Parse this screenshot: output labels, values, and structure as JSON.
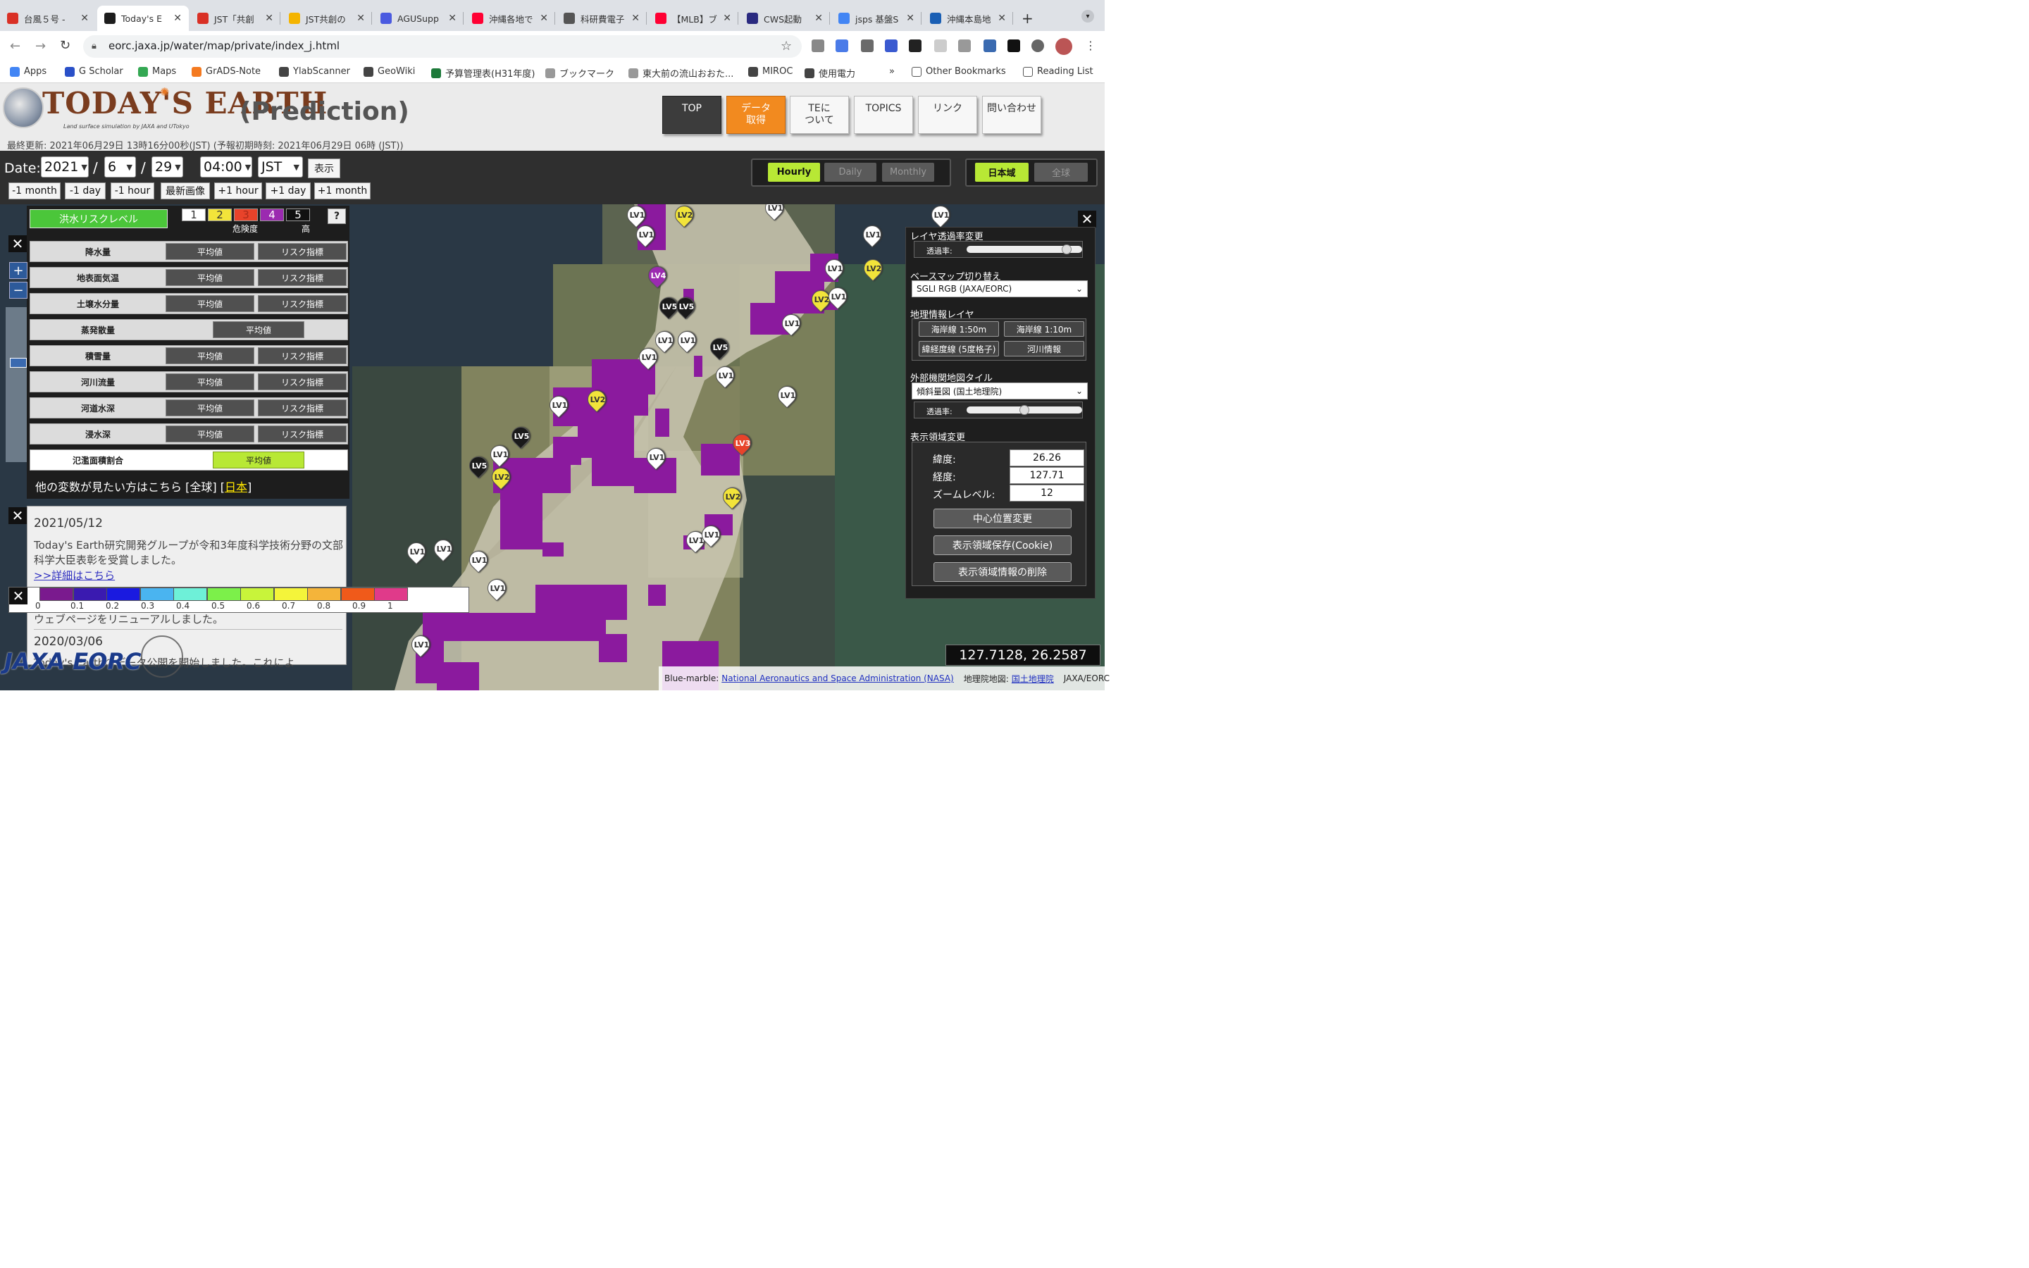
{
  "browser": {
    "tabs": [
      {
        "title": "台風５号 -",
        "favicon": "gmail-icon",
        "color": "#d93025"
      },
      {
        "title": "Today's E",
        "favicon": "eorc-icon",
        "color": "#1d1d1d"
      },
      {
        "title": "JST「共創",
        "favicon": "gmail-icon",
        "color": "#d93025"
      },
      {
        "title": "JST共創の",
        "favicon": "drive-icon",
        "color": "#f4b400"
      },
      {
        "title": "AGUSupp",
        "favicon": "dropbox-icon",
        "color": "#4a5ae0"
      },
      {
        "title": "沖縄各地で",
        "favicon": "yahoo-icon",
        "color": "#ff0033"
      },
      {
        "title": "科研費電子",
        "favicon": "globe-icon",
        "color": "#555555"
      },
      {
        "title": "【MLB】ブ",
        "favicon": "yahoo-icon",
        "color": "#ff0033"
      },
      {
        "title": "CWS起動",
        "favicon": "sphere-icon",
        "color": "#2a2a80"
      },
      {
        "title": "jsps 基盤S",
        "favicon": "google-icon",
        "color": "#4285f4"
      },
      {
        "title": "沖縄本島地",
        "favicon": "nhk-icon",
        "color": "#1a5fb4"
      }
    ],
    "url": "eorc.jaxa.jp/water/map/private/index_j.html",
    "bookmarks": [
      "Apps",
      "G Scholar",
      "Maps",
      "GrADS-Note",
      "YlabScanner",
      "GeoWiki",
      "予算管理表(H31年度)",
      "ブックマーク",
      "東大前の流山おおた...",
      "MIROC",
      "使用電力"
    ],
    "bookmarks_overflow": "»",
    "other_bookmarks": "Other Bookmarks",
    "reading_list": "Reading List"
  },
  "header": {
    "logo_title": "TODAY'S EARTH",
    "logo_subtitle": "Land surface simulation by JAXA and UTokyo",
    "mode": "(Prediction)",
    "last_update": "最終更新: 2021年06月29日 13時16分00秒(JST) (予報初期時刻: 2021年06月29日 06時 (JST))",
    "nav": [
      {
        "label": "TOP",
        "style": "dark"
      },
      {
        "label": "データ\n取得",
        "style": "orange"
      },
      {
        "label": "TEに\nついて",
        "style": "normal"
      },
      {
        "label": "TOPICS",
        "style": "normal"
      },
      {
        "label": "リンク",
        "style": "normal"
      },
      {
        "label": "問い合わせ",
        "style": "normal"
      }
    ]
  },
  "datebar": {
    "label": "Date:",
    "year": "2021",
    "month": "6",
    "day": "29",
    "time": "04:00",
    "tz": "JST",
    "show": "表示",
    "steps": [
      "-1 month",
      "-1 day",
      "-1 hour",
      "最新画像",
      "+1 hour",
      "+1 day",
      "+1 month"
    ],
    "interval": {
      "options": [
        "Hourly",
        "Daily",
        "Monthly"
      ],
      "selected": "Hourly"
    },
    "region": {
      "options": [
        "日本域",
        "全球"
      ],
      "selected": "日本域"
    }
  },
  "varpanel": {
    "risk_label": "洪水リスクレベル",
    "levels": [
      {
        "n": "1",
        "color": "#ffffff",
        "text": "#333333"
      },
      {
        "n": "2",
        "color": "#f2e43a",
        "text": "#333333"
      },
      {
        "n": "3",
        "color": "#e8432a",
        "text": "#aa2a1a"
      },
      {
        "n": "4",
        "color": "#9b2ab0",
        "text": "#ffffff"
      },
      {
        "n": "5",
        "color": "#111111",
        "text": "#ffffff"
      }
    ],
    "level_caption": "危険度",
    "level_high": "高",
    "help": "?",
    "rows": [
      {
        "name": "降水量",
        "buttons": [
          "平均値",
          "リスク指標"
        ]
      },
      {
        "name": "地表面気温",
        "buttons": [
          "平均値",
          "リスク指標"
        ]
      },
      {
        "name": "土壌水分量",
        "buttons": [
          "平均値",
          "リスク指標"
        ]
      },
      {
        "name": "蒸発散量",
        "buttons": [
          "平均値"
        ]
      },
      {
        "name": "積雪量",
        "buttons": [
          "平均値",
          "リスク指標"
        ]
      },
      {
        "name": "河川流量",
        "buttons": [
          "平均値",
          "リスク指標"
        ]
      },
      {
        "name": "河道水深",
        "buttons": [
          "平均値",
          "リスク指標"
        ]
      },
      {
        "name": "浸水深",
        "buttons": [
          "平均値",
          "リスク指標"
        ]
      },
      {
        "name": "氾濫面積割合",
        "buttons": [
          "平均値"
        ],
        "active": true
      }
    ],
    "other_prefix": "他の変数が見たい方はこちら",
    "other_global": "[全球]",
    "other_japan": "日本"
  },
  "news": {
    "date1": "2021/05/12",
    "text1": "Today's Earth研究開発グループが令和3年度科学技術分野の文部科学大臣表彰を受賞しました。",
    "link1": ">>詳細はこちら",
    "text2": "ウェブページをリニューアルしました。",
    "date2": "2020/03/06",
    "text3": "Today's Earthのデータ公開を開始しました。これによ"
  },
  "colorbar": {
    "colors": [
      "#7a1a8e",
      "#3a1ab0",
      "#1a1ae0",
      "#4ab4f0",
      "#6ef0d8",
      "#7cf04a",
      "#c8f43a",
      "#f4f43a",
      "#f4b43a",
      "#f05a1a",
      "#e03a8a"
    ],
    "ticks": [
      "0",
      "0.1",
      "0.2",
      "0.3",
      "0.4",
      "0.5",
      "0.6",
      "0.7",
      "0.8",
      "0.9",
      "1"
    ]
  },
  "rpanel": {
    "opacity_head": "レイヤ透過率変更",
    "opacity_label": "透過率:",
    "opacity_value": 0.9,
    "basemap_head": "ベースマップ切り替え",
    "basemap_value": "SGLI RGB (JAXA/EORC)",
    "geo_head": "地理情報レイヤ",
    "geo_buttons": [
      "海岸線 1:50m",
      "海岸線 1:10m",
      "緯経度線 (5度格子)",
      "河川情報"
    ],
    "ext_head": "外部機関地図タイル",
    "ext_value": "傾斜量図 (国土地理院)",
    "ext_opacity_label": "透過率:",
    "ext_opacity_value": 0.5,
    "region_head": "表示領域変更",
    "lat_label": "緯度:",
    "lat": "26.26",
    "lon_label": "経度:",
    "lon": "127.71",
    "zoom_label": "ズームレベル:",
    "zoom": "12",
    "btn_center": "中心位置変更",
    "btn_save": "表示領域保存(Cookie)",
    "btn_delete": "表示領域情報の削除"
  },
  "coords": "127.7128, 26.2587",
  "attribution": {
    "bm_prefix": "Blue-marble:",
    "bm_link": "National Aeronautics and Space Administration (NASA)",
    "gsi_prefix": "地理院地図:",
    "gsi_link": "国土地理院",
    "credit": "JAXA/EORC"
  },
  "logos": {
    "jaxa": "JAXA EORC"
  },
  "markers": [
    {
      "lv": "1"
    },
    {
      "lv": "2"
    },
    {
      "lv": "1"
    },
    {
      "lv": "1"
    },
    {
      "lv": "1"
    },
    {
      "lv": "1"
    },
    {
      "lv": "4"
    },
    {
      "lv": "1"
    },
    {
      "lv": "2"
    },
    {
      "lv": "1"
    },
    {
      "lv": "5"
    },
    {
      "lv": "5"
    },
    {
      "lv": "2"
    },
    {
      "lv": "1"
    },
    {
      "lv": "2"
    },
    {
      "lv": "1"
    },
    {
      "lv": "1"
    },
    {
      "lv": "1"
    },
    {
      "lv": "5"
    },
    {
      "lv": "1"
    },
    {
      "lv": "1"
    },
    {
      "lv": "1"
    },
    {
      "lv": "1"
    },
    {
      "lv": "2"
    },
    {
      "lv": "5"
    },
    {
      "lv": "1"
    },
    {
      "lv": "5"
    },
    {
      "lv": "2"
    },
    {
      "lv": "1"
    },
    {
      "lv": "3"
    },
    {
      "lv": "2"
    },
    {
      "lv": "1"
    },
    {
      "lv": "1"
    },
    {
      "lv": "1"
    },
    {
      "lv": "1"
    },
    {
      "lv": "1"
    },
    {
      "lv": "1"
    },
    {
      "lv": "1"
    },
    {
      "lv": "2"
    },
    {
      "lv": "2"
    }
  ]
}
